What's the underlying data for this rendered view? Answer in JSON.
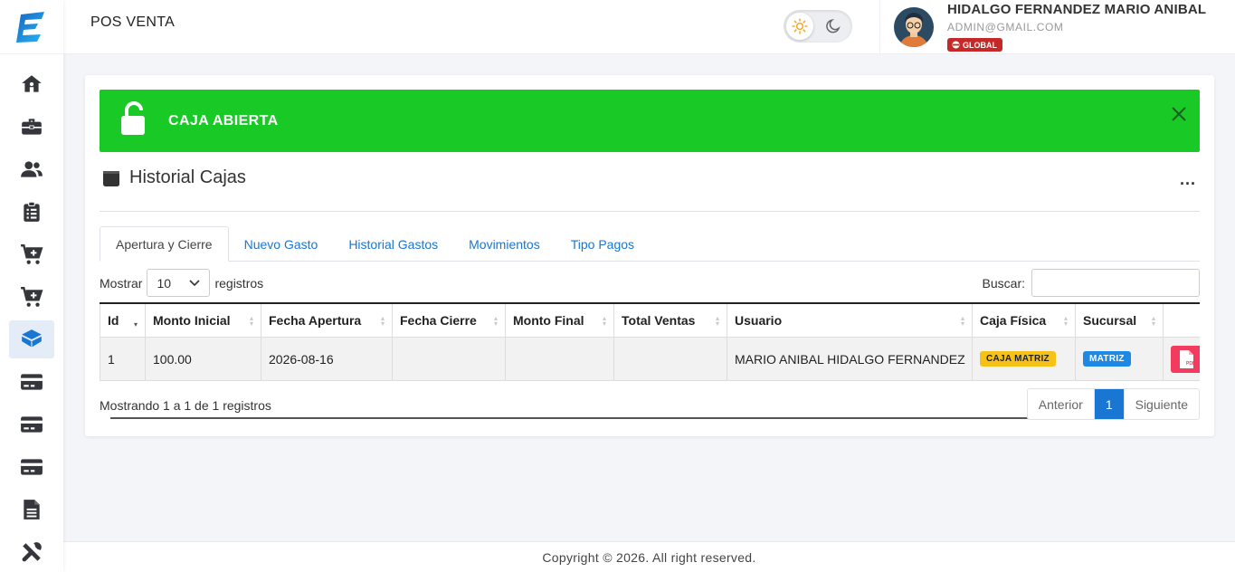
{
  "header": {
    "title": "POS VENTA",
    "user_name": "HIDALGO FERNANDEZ MARIO ANIBAL",
    "user_email": "ADMIN@GMAIL.COM",
    "user_badge": "GLOBAL"
  },
  "sidebar": {
    "items": [
      {
        "icon": "home-icon"
      },
      {
        "icon": "briefcase-icon"
      },
      {
        "icon": "users-icon"
      },
      {
        "icon": "clipboard-list-icon"
      },
      {
        "icon": "cart-plus-icon"
      },
      {
        "icon": "cart-plus-icon"
      },
      {
        "icon": "cash-register-icon",
        "active": true
      },
      {
        "icon": "credit-card-icon"
      },
      {
        "icon": "credit-card-icon"
      },
      {
        "icon": "credit-card-icon"
      },
      {
        "icon": "file-icon"
      },
      {
        "icon": "tools-icon"
      }
    ]
  },
  "alert": {
    "text": "CAJA ABIERTA",
    "color": "#19c925"
  },
  "section": {
    "title": "Historial Cajas",
    "more": "..."
  },
  "tabs": [
    {
      "label": "Apertura y Cierre",
      "active": true
    },
    {
      "label": "Nuevo Gasto"
    },
    {
      "label": "Historial Gastos"
    },
    {
      "label": "Movimientos"
    },
    {
      "label": "Tipo Pagos"
    }
  ],
  "controls": {
    "show_label": "Mostrar",
    "page_size": "10",
    "records_label": "registros",
    "search_label": "Buscar:",
    "search_value": ""
  },
  "table": {
    "columns": [
      "Id",
      "Monto Inicial",
      "Fecha Apertura",
      "Fecha Cierre",
      "Monto Final",
      "Total Ventas",
      "Usuario",
      "Caja Física",
      "Sucursal",
      ""
    ],
    "rows": [
      {
        "id": "1",
        "monto_inicial": "100.00",
        "fecha_apertura": "2026-08-16",
        "fecha_cierre": "",
        "monto_final": "",
        "total_ventas": "",
        "usuario": "MARIO ANIBAL HIDALGO FERNANDEZ",
        "caja_fisica": "CAJA MATRIZ",
        "sucursal": "MATRIZ",
        "action": "PDF"
      }
    ]
  },
  "pagination": {
    "info": "Mostrando 1 a 1 de 1 registros",
    "previous": "Anterior",
    "current": "1",
    "next": "Siguiente"
  },
  "footer": {
    "text": "Copyright © 2026. All right reserved."
  },
  "colors": {
    "accent": "#1976d2",
    "danger": "#f23b5d",
    "warning": "#f6c217"
  }
}
